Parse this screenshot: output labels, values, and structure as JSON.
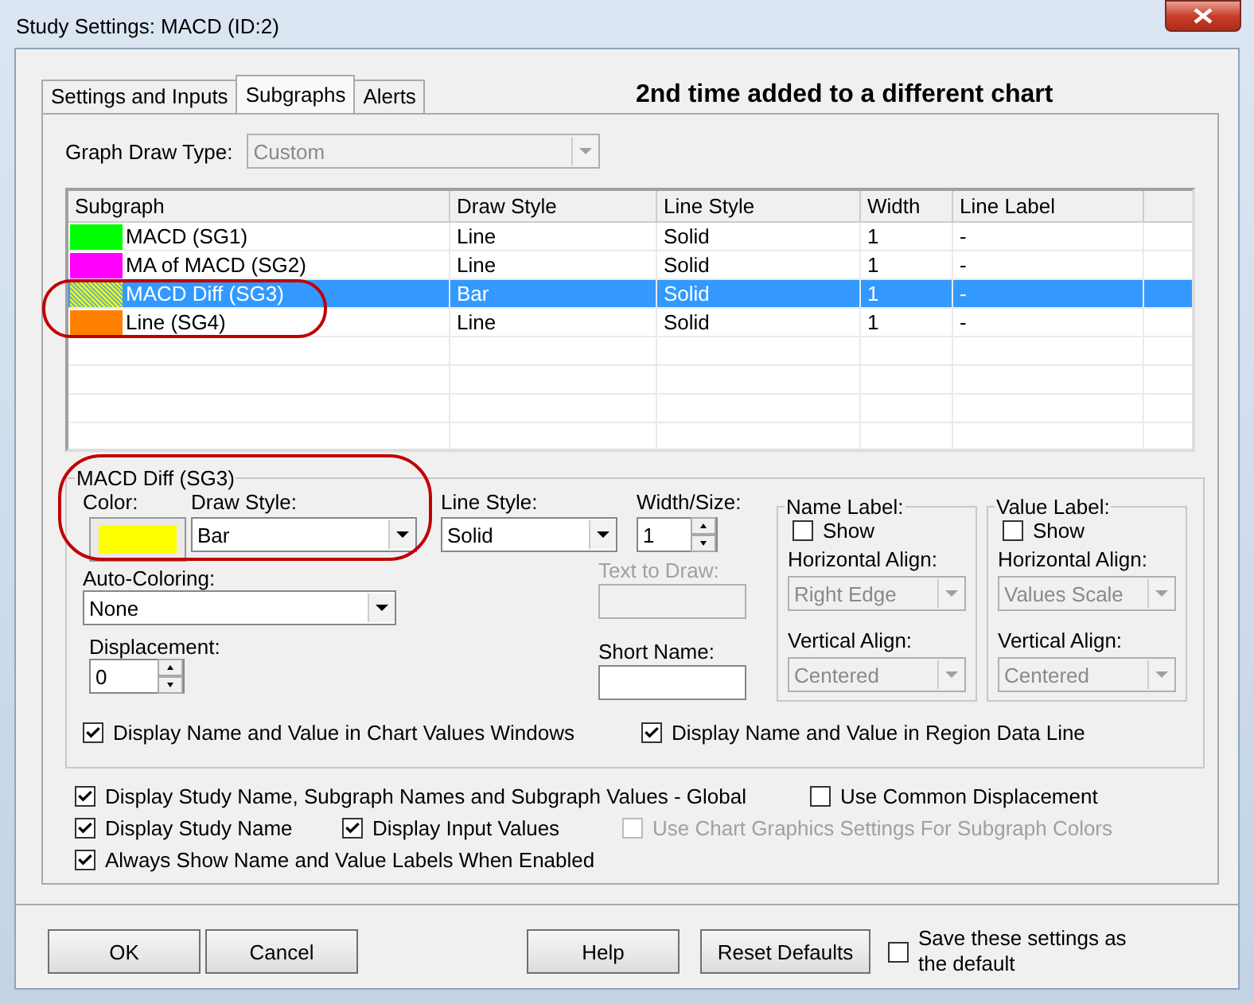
{
  "window": {
    "title": "Study Settings: MACD (ID:2)"
  },
  "tabs": [
    {
      "label": "Settings and Inputs",
      "selected": false
    },
    {
      "label": "Subgraphs",
      "selected": true
    },
    {
      "label": "Alerts",
      "selected": false
    }
  ],
  "note": "2nd time added to a different chart",
  "graph_draw_type": {
    "label": "Graph Draw Type:",
    "value": "Custom",
    "disabled": true
  },
  "table": {
    "columns": [
      "Subgraph",
      "Draw Style",
      "Line Style",
      "Width",
      "Line Label"
    ],
    "rows": [
      {
        "color": "#00ff00",
        "cells": [
          "MACD (SG1)",
          "Line",
          "Solid",
          "1",
          "-"
        ],
        "selected": false
      },
      {
        "color": "#ff00ff",
        "cells": [
          "MA of MACD (SG2)",
          "Line",
          "Solid",
          "1",
          "-"
        ],
        "selected": false
      },
      {
        "color": "#ffff00",
        "cells": [
          "MACD Diff (SG3)",
          "Bar",
          "Solid",
          "1",
          "-"
        ],
        "selected": true
      },
      {
        "color": "#ff8000",
        "cells": [
          "Line (SG4)",
          "Line",
          "Solid",
          "1",
          "-"
        ],
        "selected": false
      }
    ]
  },
  "subgraph_settings": {
    "title": "MACD Diff (SG3)",
    "color_label": "Color:",
    "color": "#ffff00",
    "draw_style": {
      "label": "Draw Style:",
      "value": "Bar"
    },
    "line_style": {
      "label": "Line Style:",
      "value": "Solid"
    },
    "width": {
      "label": "Width/Size:",
      "value": "1"
    },
    "auto_coloring": {
      "label": "Auto-Coloring:",
      "value": "None"
    },
    "displacement": {
      "label": "Displacement:",
      "value": "0"
    },
    "text_to_draw": {
      "label": "Text to Draw:",
      "disabled": true
    },
    "short_name": {
      "label": "Short Name:",
      "disabled": false
    },
    "label_groups": [
      {
        "title": "Name Label:",
        "show": {
          "label": "Show",
          "checked": false
        },
        "horizontal": {
          "label": "Horizontal Align:",
          "value": "Right Edge",
          "disabled": true
        },
        "vertical": {
          "label": "Vertical Align:",
          "value": "Centered",
          "disabled": true
        }
      },
      {
        "title": "Value Label:",
        "show": {
          "label": "Show",
          "checked": false
        },
        "horizontal": {
          "label": "Horizontal Align:",
          "value": "Values Scale",
          "disabled": true
        },
        "vertical": {
          "label": "Vertical Align:",
          "value": "Centered",
          "disabled": true
        }
      }
    ],
    "bottom_checks": [
      {
        "label": "Display Name and Value in Chart Values Windows",
        "checked": true
      },
      {
        "label": "Display Name and Value in Region Data Line",
        "checked": true
      }
    ]
  },
  "options": [
    [
      {
        "label": "Display Study Name, Subgraph Names and Subgraph Values - Global",
        "checked": true,
        "disabled": false
      },
      {
        "label": "Use Common Displacement",
        "checked": false,
        "disabled": false
      }
    ],
    [
      {
        "label": "Display Study Name",
        "checked": true,
        "disabled": false
      },
      {
        "label": "Display Input Values",
        "checked": true,
        "disabled": false
      },
      {
        "label": "Use Chart Graphics Settings For Subgraph Colors",
        "checked": false,
        "disabled": true
      }
    ],
    [
      {
        "label": "Always Show Name and Value Labels When Enabled",
        "checked": true,
        "disabled": false
      }
    ]
  ],
  "buttons": [
    {
      "label": "OK"
    },
    {
      "label": "Cancel"
    },
    {
      "label": "Help"
    },
    {
      "label": "Reset Defaults"
    }
  ],
  "save_default": {
    "label": "Save these settings as the default",
    "checked": false
  }
}
